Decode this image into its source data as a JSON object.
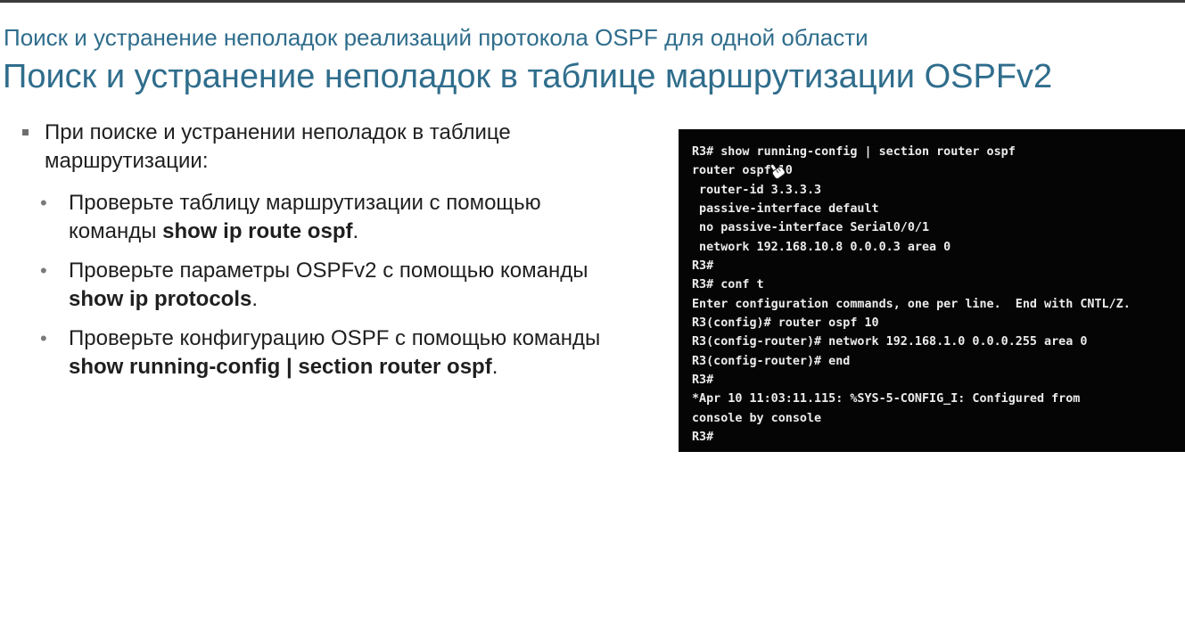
{
  "header": {
    "subtitle": "Поиск и устранение неполадок реализаций протокола OSPF для одной области",
    "title": "Поиск и устранение неполадок в таблице маршрутизации OSPFv2"
  },
  "main_bullet": "При поиске и устранении неполадок в таблице маршрутизации:",
  "sub_bullets": [
    {
      "text": "Проверьте таблицу маршрутизации с помощью команды ",
      "cmd": "show ip route ospf",
      "end": "."
    },
    {
      "text": "Проверьте параметры OSPFv2 с помощью команды ",
      "cmd": "show ip protocols",
      "end": "."
    },
    {
      "text": "Проверьте конфигурацию OSPF с помощью команды ",
      "cmd": "show running-config | section router ospf",
      "end": "."
    }
  ],
  "terminal": {
    "lines": [
      "R3# show running-config | section router ospf",
      "router ospf 10",
      " router-id 3.3.3.3",
      " passive-interface default",
      " no passive-interface Serial0/0/1",
      " network 192.168.10.8 0.0.0.3 area 0",
      "R3#",
      "R3# conf t",
      "Enter configuration commands, one per line.  End with CNTL/Z.",
      "R3(config)# router ospf 10",
      "R3(config-router)# network 192.168.1.0 0.0.0.255 area 0",
      "R3(config-router)# end",
      "R3#",
      "*Apr 10 11:03:11.115: %SYS-5-CONFIG_I: Configured from",
      "console by console",
      "R3#"
    ]
  }
}
